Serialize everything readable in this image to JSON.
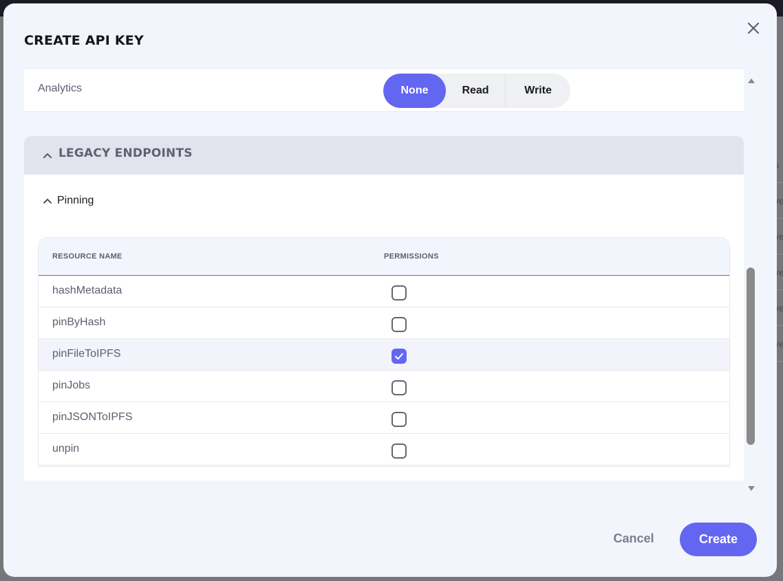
{
  "background": {
    "right_column_fragments": [
      "s",
      "ve",
      "ve",
      "ve",
      "ve",
      "ve"
    ]
  },
  "modal": {
    "title": "CREATE API KEY",
    "close_icon": "close-icon"
  },
  "analytics": {
    "label": "Analytics",
    "options": [
      "None",
      "Read",
      "Write"
    ],
    "selected": "None"
  },
  "legacy": {
    "title": "LEGACY ENDPOINTS",
    "expanded": true,
    "pinning": {
      "label": "Pinning",
      "expanded": true,
      "columns": [
        "RESOURCE NAME",
        "PERMISSIONS"
      ],
      "rows": [
        {
          "name": "hashMetadata",
          "checked": false
        },
        {
          "name": "pinByHash",
          "checked": false
        },
        {
          "name": "pinFileToIPFS",
          "checked": true
        },
        {
          "name": "pinJobs",
          "checked": false
        },
        {
          "name": "pinJSONToIPFS",
          "checked": false
        },
        {
          "name": "unpin",
          "checked": false
        }
      ]
    }
  },
  "footer": {
    "cancel_label": "Cancel",
    "create_label": "Create"
  },
  "colors": {
    "accent": "#6366f1",
    "modal_bg": "#f3f5fd",
    "section_header_bg": "#e2e3ed"
  }
}
